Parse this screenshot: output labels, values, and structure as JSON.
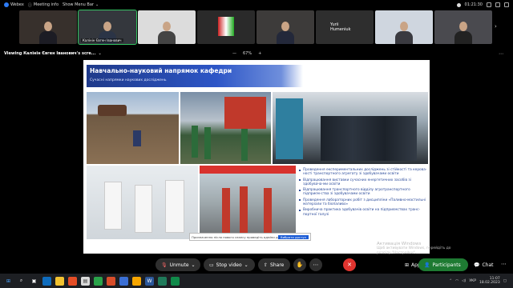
{
  "topbar": {
    "app_name": "Webex",
    "meeting_info": "Meeting info",
    "show_menu_bar": "Show Menu Bar",
    "time": "01:21:30"
  },
  "participants_strip": [
    {
      "name": "",
      "type": "video"
    },
    {
      "name": "Калінін Євген Іванович",
      "type": "video",
      "active": true
    },
    {
      "name": "",
      "type": "video"
    },
    {
      "name": "",
      "type": "video"
    },
    {
      "name": "",
      "type": "video"
    },
    {
      "name": "Yurii Humeniuk",
      "type": "name"
    },
    {
      "name": "",
      "type": "video"
    },
    {
      "name": "",
      "type": "video"
    }
  ],
  "viewing_bar": {
    "label": "Viewing Калінін Євген Іванович's scre...",
    "zoom_out": "—",
    "zoom": "67%",
    "zoom_in": "+"
  },
  "slide": {
    "title": "Навчально-науковий напрямок кафедри",
    "subtitle": "Сучасні напрямки наукових досліджень",
    "bullets": [
      "Проведення експериментальних досліджень зі стійкості та керова-ності транспортного агрегату зі здобувачами освіти",
      "Відпрацювання виставки сучасних енергетичних засобів зі здобувача-ми освіти",
      "Відпрацювання транспортного відділу агротранспортного підприєм-ства зі здобувачами освіти",
      "Проведення лабораторних робіт з дисципліни «Паливно-мастильні матеріали та біопаливо»",
      "Виробнича практика здобувачів освіти на підприємствах транс-портної галузі"
    ],
    "notice_text": "Призначення після нового сеансу проведіть адміни до майна з акаунта",
    "notice_button": "Вибрати доступ"
  },
  "activation": {
    "line1": "Активація Windows",
    "line2": "Щоб активувати Windows, перейдіть до",
    "line3": "розділу \"Настройки\"."
  },
  "toolbar": {
    "unmute": "Unmute",
    "stop_video": "Stop video",
    "share": "Share",
    "apps": "Apps",
    "participants": "Participants",
    "chat": "Chat"
  },
  "taskbar": {
    "language": "УКР",
    "time": "11:07",
    "date": "18.02.2023"
  }
}
